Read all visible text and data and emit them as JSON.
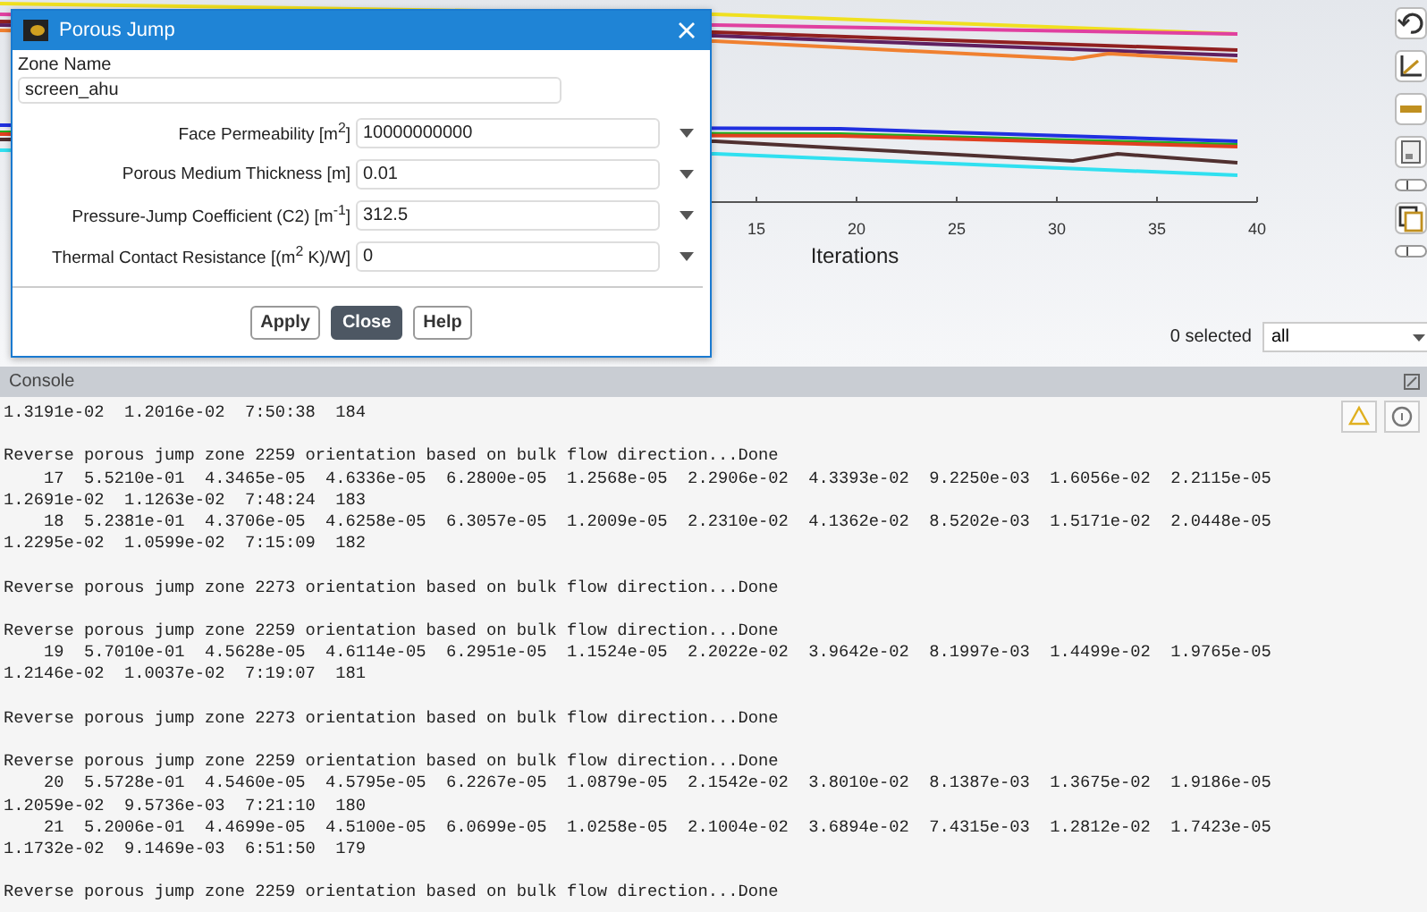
{
  "dialog": {
    "title": "Porous Jump",
    "zone_label": "Zone Name",
    "zone_value": "screen_ahu",
    "fields": [
      {
        "label": "Face Permeability [m$^{2}$]",
        "value": "10000000000"
      },
      {
        "label": "Porous Medium Thickness [m]",
        "value": "0.01"
      },
      {
        "label": "Pressure-Jump Coefficient (C2) [m$^{-1}$]",
        "value": "312.5"
      },
      {
        "label": "Thermal Contact Resistance [(m$^{2}$ K)/W]",
        "value": "0"
      }
    ],
    "buttons": [
      {
        "label": "Apply",
        "default": false
      },
      {
        "label": "Close",
        "default": true
      },
      {
        "label": "Help",
        "default": false
      }
    ]
  },
  "plot": {
    "xticks": [
      "15",
      "20",
      "25",
      "30",
      "35",
      "40"
    ],
    "xlabel": "Iterations",
    "selection_count": "0 selected",
    "selection_filter": "all"
  },
  "console": {
    "title": "Console",
    "blocks": [
      [
        "1.3191e-02  1.2016e-02  7:50:38  184"
      ],
      [
        "Reverse porous jump zone 2259 orientation based on bulk flow direction...Done",
        "    17  5.5210e-01  4.3465e-05  4.6336e-05  6.2800e-05  1.2568e-05  2.2906e-02  4.3393e-02  9.2250e-03  1.6056e-02  2.2115e-05",
        "1.2691e-02  1.1263e-02  7:48:24  183",
        "    18  5.2381e-01  4.3706e-05  4.6258e-05  6.3057e-05  1.2009e-05  2.2310e-02  4.1362e-02  8.5202e-03  1.5171e-02  2.0448e-05",
        "1.2295e-02  1.0599e-02  7:15:09  182"
      ],
      [
        "Reverse porous jump zone 2273 orientation based on bulk flow direction...Done"
      ],
      [
        "Reverse porous jump zone 2259 orientation based on bulk flow direction...Done",
        "    19  5.7010e-01  4.5628e-05  4.6114e-05  6.2951e-05  1.1524e-05  2.2022e-02  3.9642e-02  8.1997e-03  1.4499e-02  1.9765e-05",
        "1.2146e-02  1.0037e-02  7:19:07  181"
      ],
      [
        "Reverse porous jump zone 2273 orientation based on bulk flow direction...Done"
      ],
      [
        "Reverse porous jump zone 2259 orientation based on bulk flow direction...Done",
        "    20  5.5728e-01  4.5460e-05  4.5795e-05  6.2267e-05  1.0879e-05  2.1542e-02  3.8010e-02  8.1387e-03  1.3675e-02  1.9186e-05",
        "1.2059e-02  9.5736e-03  7:21:10  180",
        "    21  5.2006e-01  4.4699e-05  4.5100e-05  6.0699e-05  1.0258e-05  2.1004e-02  3.6894e-02  7.4315e-03  1.2812e-02  1.7423e-05",
        "1.1732e-02  9.1469e-03  6:51:50  179"
      ],
      [
        "Reverse porous jump zone 2259 orientation based on bulk flow direction...Done"
      ]
    ]
  }
}
